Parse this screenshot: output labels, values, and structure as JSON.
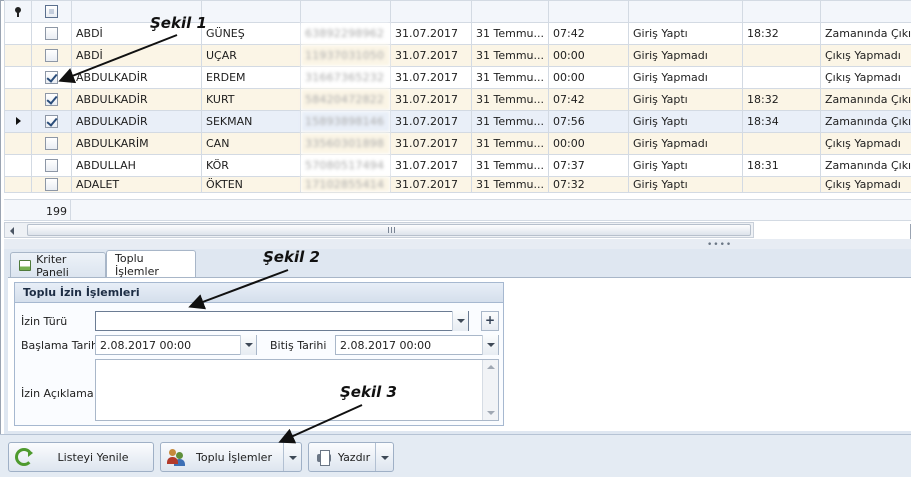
{
  "grid": {
    "rows": [
      {
        "checked": false,
        "focused": false,
        "cells": [
          "ABDİ",
          "GÜNEŞ",
          "63892298962",
          "31.07.2017",
          "31 Temmu...",
          "07:42",
          "Giriş Yaptı",
          "18:32",
          "Zamanında Çıkış Y"
        ]
      },
      {
        "checked": false,
        "focused": false,
        "cells": [
          "ABDİ",
          "UÇAR",
          "11937031050",
          "31.07.2017",
          "31 Temmu...",
          "00:00",
          "Giriş Yapmadı",
          "",
          "Çıkış Yapmadı"
        ]
      },
      {
        "checked": true,
        "focused": false,
        "cells": [
          "ABDULKADİR",
          "ERDEM",
          "31667365232",
          "31.07.2017",
          "31 Temmu...",
          "00:00",
          "Giriş Yapmadı",
          "",
          "Çıkış Yapmadı"
        ]
      },
      {
        "checked": true,
        "focused": false,
        "cells": [
          "ABDULKADİR",
          "KURT",
          "58420472822",
          "31.07.2017",
          "31 Temmu...",
          "07:42",
          "Giriş Yaptı",
          "18:32",
          "Zamanında Çıkış Y"
        ]
      },
      {
        "checked": true,
        "focused": true,
        "cells": [
          "ABDULKADİR",
          "SEKMAN",
          "15893898146",
          "31.07.2017",
          "31 Temmu...",
          "07:56",
          "Giriş Yaptı",
          "18:34",
          "Zamanında Çıkış Y"
        ]
      },
      {
        "checked": false,
        "focused": false,
        "cells": [
          "ABDULKARİM",
          "CAN",
          "33560301898",
          "31.07.2017",
          "31 Temmu...",
          "00:00",
          "Giriş Yapmadı",
          "",
          "Çıkış Yapmadı"
        ]
      },
      {
        "checked": false,
        "focused": false,
        "cells": [
          "ABDULLAH",
          "KÖR",
          "57080517494",
          "31.07.2017",
          "31 Temmu...",
          "07:37",
          "Giriş Yaptı",
          "18:31",
          "Zamanında Çıkış Y"
        ]
      },
      {
        "checked": false,
        "focused": false,
        "cells": [
          "ADALET",
          "ÖKTEN",
          "17102855414",
          "31.07.2017",
          "31 Temmu...",
          "07:32",
          "Giriş Yaptı",
          "",
          "Çıkış Yapmadı"
        ]
      }
    ],
    "footer_count": "199"
  },
  "tabs": [
    {
      "label": "Kriter Paneli",
      "icon": "panel-icon",
      "active": false
    },
    {
      "label": "Toplu İşlemler",
      "active": true
    }
  ],
  "group": {
    "title": "Toplu İzin İşlemleri",
    "izin_turu_label": "İzin Türü",
    "izin_turu_value": "",
    "baslama_label": "Başlama Tarihi",
    "baslama_value": "2.08.2017 00:00",
    "bitis_label": "Bitiş Tarihi",
    "bitis_value": "2.08.2017 00:00",
    "aciklama_label": "İzin Açıklama",
    "aciklama_value": "",
    "plus_label": "+"
  },
  "buttons": {
    "refresh": "Listeyi Yenile",
    "bulk": "Toplu İşlemler",
    "print": "Yazdır"
  },
  "annotations": {
    "a1": "Şekil 1",
    "a2": "Şekil 2",
    "a3": "Şekil 3"
  },
  "colors": {
    "row_alt": "#fbf5e6",
    "row_focus": "#e9eff8",
    "panel_bg": "#dfe7f1",
    "accent_green": "#4e9a2e"
  }
}
